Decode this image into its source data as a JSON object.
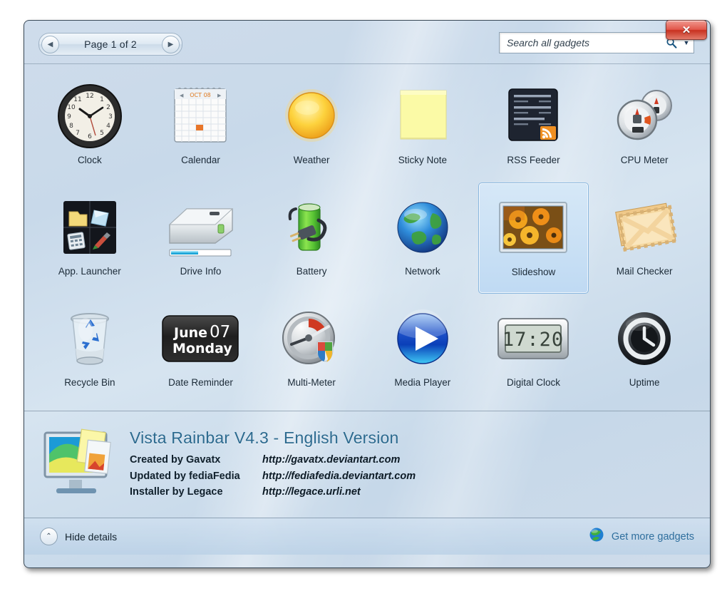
{
  "window": {
    "close_label": "✕",
    "accent": "#2c6a8f",
    "selected_gadget": "Slideshow"
  },
  "toolbar": {
    "prev_label": "◀",
    "next_label": "▶",
    "page_text": "Page 1 of 2",
    "search": {
      "value": "",
      "placeholder": "Search all gadgets",
      "dropdown_label": "▼"
    }
  },
  "gadgets": [
    {
      "label": "Clock",
      "icon": "analog-clock-icon"
    },
    {
      "label": "Calendar",
      "icon": "calendar-icon",
      "month": "OCT 08"
    },
    {
      "label": "Weather",
      "icon": "sun-icon"
    },
    {
      "label": "Sticky Note",
      "icon": "sticky-note-icon"
    },
    {
      "label": "RSS Feeder",
      "icon": "rss-feed-icon"
    },
    {
      "label": "CPU Meter",
      "icon": "cpu-gauges-icon"
    },
    {
      "label": "App. Launcher",
      "icon": "app-launcher-icon"
    },
    {
      "label": "Drive Info",
      "icon": "hard-drive-icon"
    },
    {
      "label": "Battery",
      "icon": "battery-plug-icon"
    },
    {
      "label": "Network",
      "icon": "globe-icon"
    },
    {
      "label": "Slideshow",
      "icon": "photo-slideshow-icon"
    },
    {
      "label": "Mail Checker",
      "icon": "envelope-icon"
    },
    {
      "label": "Recycle Bin",
      "icon": "recycle-bin-icon"
    },
    {
      "label": "Date Reminder",
      "icon": "date-reminder-icon",
      "month": "June",
      "day": "07",
      "weekday": "Monday"
    },
    {
      "label": "Multi-Meter",
      "icon": "gauge-shield-icon"
    },
    {
      "label": "Media Player",
      "icon": "play-button-icon"
    },
    {
      "label": "Digital Clock",
      "icon": "lcd-clock-icon",
      "time": "17:20"
    },
    {
      "label": "Uptime",
      "icon": "dark-clock-icon"
    }
  ],
  "details": {
    "title": "Vista Rainbar V4.3 - English Version",
    "rows": [
      {
        "label": "Created by Gavatx",
        "url": "http://gavatx.deviantart.com"
      },
      {
        "label": "Updated by fediaFedia",
        "url": "http://fediafedia.deviantart.com"
      },
      {
        "label": "Installer by Legace",
        "url": "http://legace.urli.net"
      }
    ]
  },
  "footer": {
    "hide_details_label": "Hide details",
    "hide_details_icon": "⌃",
    "get_more_label": "Get more gadgets"
  }
}
